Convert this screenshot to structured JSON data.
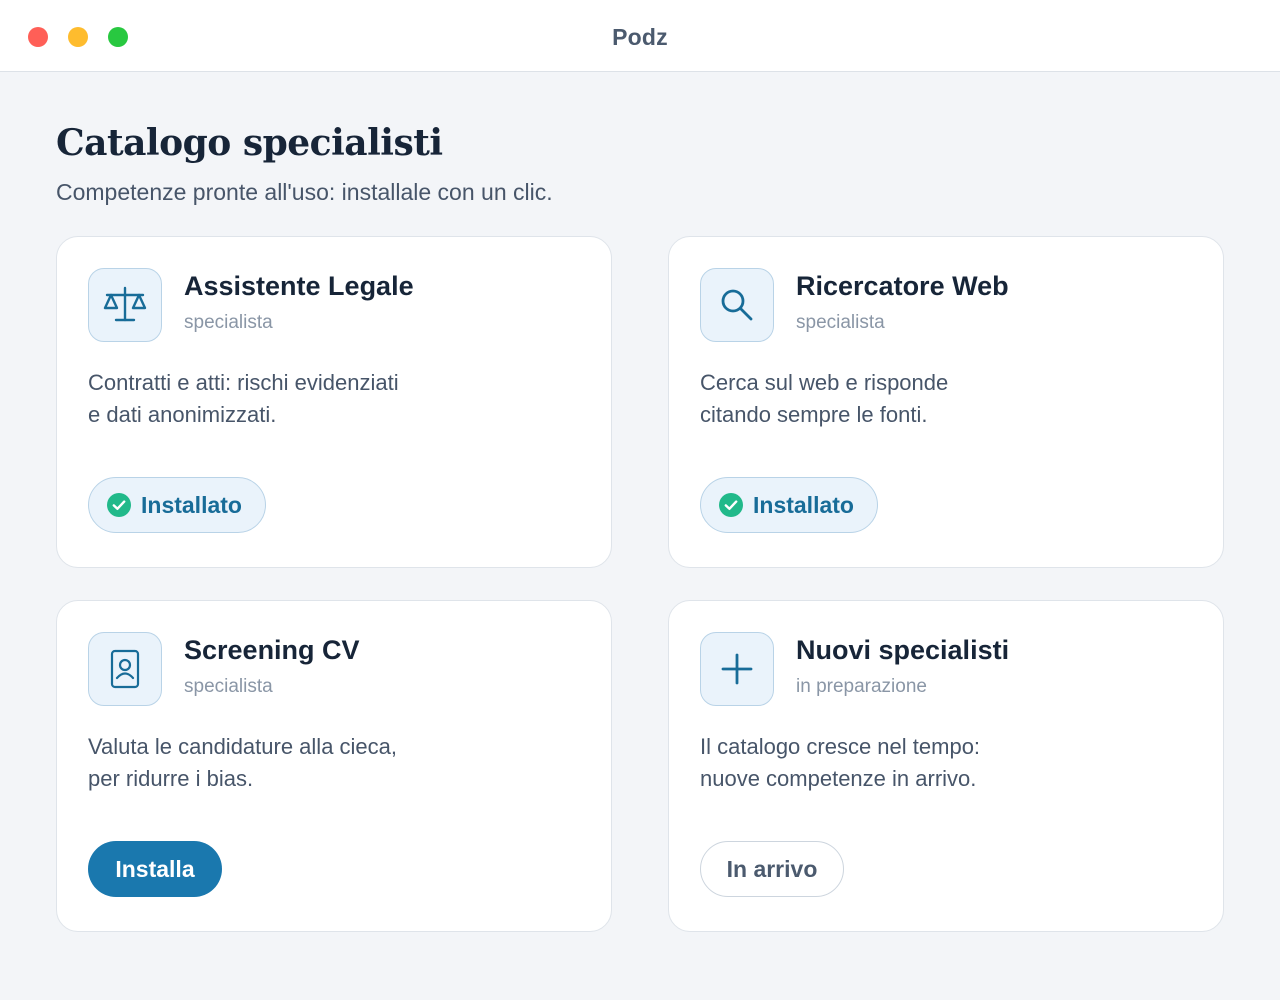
{
  "window": {
    "title": "Podz"
  },
  "header": {
    "title": "Catalogo specialisti",
    "subtitle": "Competenze pronte all'uso: installale con un clic."
  },
  "colors": {
    "accent": "#1a78ae",
    "installed_check": "#21b98a",
    "title_text": "#172538"
  },
  "cards": [
    {
      "name": "Assistente Legale",
      "type": "specialista",
      "icon": "scales-icon",
      "description": [
        "Contratti e atti: rischi evidenziati",
        "e dati anonimizzati."
      ],
      "action": "Installato",
      "state": "installed"
    },
    {
      "name": "Ricercatore Web",
      "type": "specialista",
      "icon": "magnifier-icon",
      "description": [
        "Cerca sul web e risponde",
        "citando sempre le fonti."
      ],
      "action": "Installato",
      "state": "installed"
    },
    {
      "name": "Screening CV",
      "type": "specialista",
      "icon": "id-badge-icon",
      "description": [
        "Valuta le candidature alla cieca,",
        "per ridurre i bias."
      ],
      "action": "Installa",
      "state": "available"
    },
    {
      "name": "Nuovi specialisti",
      "type": "in preparazione",
      "icon": "plus-icon",
      "description": [
        "Il catalogo cresce nel tempo:",
        "nuove competenze in arrivo."
      ],
      "action": "In arrivo",
      "state": "coming-soon"
    }
  ]
}
